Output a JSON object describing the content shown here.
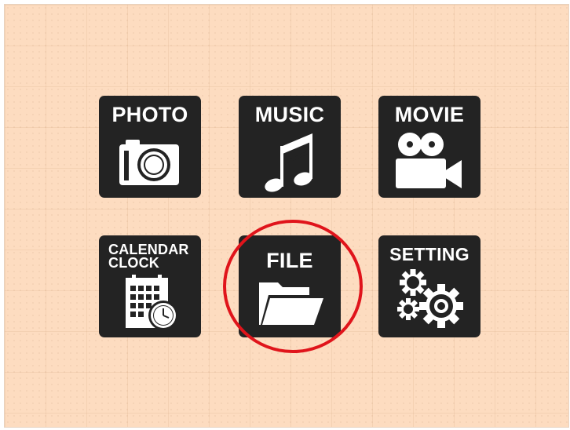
{
  "menu": {
    "tiles": [
      {
        "label": "PHOTO",
        "icon": "camera-icon"
      },
      {
        "label": "MUSIC",
        "icon": "music-note-icon"
      },
      {
        "label": "MOVIE",
        "icon": "movie-camera-icon"
      },
      {
        "label_line1": "CALENDAR",
        "label_line2": "CLOCK",
        "icon": "calendar-clock-icon"
      },
      {
        "label": "FILE",
        "icon": "folder-icon"
      },
      {
        "label": "SETTING",
        "icon": "gears-icon"
      }
    ],
    "highlighted": "FILE"
  },
  "colors": {
    "background": "#fddcc0",
    "tile": "#232323",
    "tile_text": "#ffffff",
    "highlight_ring": "#e0141b"
  }
}
